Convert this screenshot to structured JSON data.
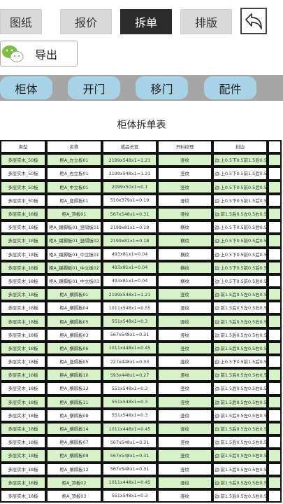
{
  "tabs": [
    "图纸",
    "报价",
    "拆单",
    "排版"
  ],
  "active_tab": "拆单",
  "export_label": "导出",
  "actions": [
    "柜体",
    "开门",
    "移门",
    "配件"
  ],
  "table_title": "柜体拆单表",
  "columns": [
    "类型",
    "名称",
    "成品长宽",
    "开料纹理",
    "封边"
  ],
  "rows": [
    [
      "多层实木_50板",
      "柜A_左立板01",
      "2199x548x1=1.21",
      "竖纹",
      "边:上0.5下0.5前1.5后0.5"
    ],
    [
      "多层实木_50板",
      "柜A_右立板01",
      "2199x548x1=1.21",
      "竖纹",
      "边:上0.5下0.5前1.5后0.5"
    ],
    [
      "多层实木_50板",
      "柜A_中立板01",
      "2099x50x1=0.1",
      "竖纹",
      "边:上0.5下0.5前0.5后0.5"
    ],
    [
      "多层实木_50板",
      "柜A_竖隔板01",
      "510x379x1=0.19",
      "竖纹",
      "边:上0.5下0.5前1.5后0.5"
    ],
    [
      "多层实木_18板",
      "柜A_顶板01",
      "567x548x1=0.31",
      "竖纹",
      "边:前1.5后0.5左0.5右0.5"
    ],
    [
      "多层实木_18板",
      "柜A_踢脚板01_竖隔板01",
      "2199x81x1=0.18",
      "横纹",
      "边:上0.5下0.5前0.5后0.5"
    ],
    [
      "多层实木_18板",
      "柜A_踢脚板01_竖隔板02",
      "2199x81x1=0.18",
      "横纹",
      "边:上0.5下0.5前0.5后0.5"
    ],
    [
      "多层实木_18板",
      "柜A_踢脚板01_中立板01",
      "493x81x1=0.04",
      "横纹",
      "边:上0.5下0.5前0.5后0.5"
    ],
    [
      "多层实木_18板",
      "柜A_踢脚板01_中立板02",
      "493x81x1=0.04",
      "横纹",
      "边:上0.5下0.5前0.5后0.5"
    ],
    [
      "多层实木_18板",
      "柜A_踢脚板01_中立板03",
      "493x81x1=0.04",
      "横纹",
      "边:上0.5下0.5前0.5后0.5"
    ],
    [
      "多层实木_18板",
      "柜A_横隔板01",
      "2199x548x1=1.21",
      "竖纹",
      "边:前1.5后0.5左0.5右0.5"
    ],
    [
      "多层实木_18板",
      "柜A_横隔板04",
      "1011x548x1=0.55",
      "竖纹",
      "边:前1.5后0.5左0.5右0.5"
    ],
    [
      "多层实木_18板",
      "柜A_横隔板05",
      "551x548x1=0.3",
      "竖纹",
      "边:前1.5后0.5左0.5右0.5"
    ],
    [
      "多层实木_18板",
      "柜A_横隔板03",
      "567x548x1=0.31",
      "竖纹",
      "边:前1.5后0.5左0.5右0.5"
    ],
    [
      "多层实木_18板",
      "柜A_横隔板06",
      "1011x448x1=0.45",
      "竖纹",
      "边:前1.5后0.5左0.5右0.5"
    ],
    [
      "多层实木_18板",
      "柜A_竖隔板05",
      "727x448x1=0.33",
      "竖纹",
      "边:上0.5下0.5前1.5后0.5"
    ],
    [
      "多层实木_18板",
      "柜A_横隔板10",
      "593x448x1=0.27",
      "竖纹",
      "边:前1.5后0.5左0.5右0.5"
    ],
    [
      "多层实木_18板",
      "柜A_横隔板13",
      "551x548x1=0.3",
      "竖纹",
      "边:前1.5后0.5左0.5右0.5"
    ],
    [
      "多层实木_18板",
      "柜A_横隔板11",
      "551x548x1=0.3",
      "竖纹",
      "边:前1.5后0.5左0.5右0.5"
    ],
    [
      "多层实木_18板",
      "柜A_横隔板08",
      "551x548x1=0.3",
      "竖纹",
      "边:前1.5后0.5左0.5右0.5"
    ],
    [
      "多层实木_18板",
      "柜A_横隔板14",
      "1011x448x1=0.45",
      "竖纹",
      "边:前1.5后0.5左0.5右0.5"
    ],
    [
      "多层实木_18板",
      "柜A_横隔板07",
      "567x548x1=0.31",
      "竖纹",
      "边:前1.5后0.5左0.5右0.5"
    ],
    [
      "多层实木_18板",
      "柜A_横隔板09",
      "567x548x1=0.31",
      "竖纹",
      "边:前1.5后0.5左0.5右0.5"
    ],
    [
      "多层实木_18板",
      "柜A_横隔板12",
      "567x548x1=0.31",
      "竖纹",
      "边:前1.5后0.5左0.5右0.5"
    ],
    [
      "多层实木_18板",
      "柜A_顶板02",
      "1011x448x1=0.45",
      "竖纹",
      "边:前1.5后0.5左0.5右0.5"
    ],
    [
      "多层实木_18板",
      "柜A_顶板03",
      "551x548x1=0.3",
      "竖纹",
      "边:前1.5后0.5左0.5右0.5"
    ]
  ],
  "colors": {
    "active_tab": "#2b2b2b",
    "tab": "#d9d9d9",
    "pill": "#a8d3e6",
    "bar": "#a6a6a6",
    "row_green": "#d7f2c9"
  },
  "icons": {
    "back": "back-arrow-icon",
    "wechat": "wechat-icon"
  }
}
